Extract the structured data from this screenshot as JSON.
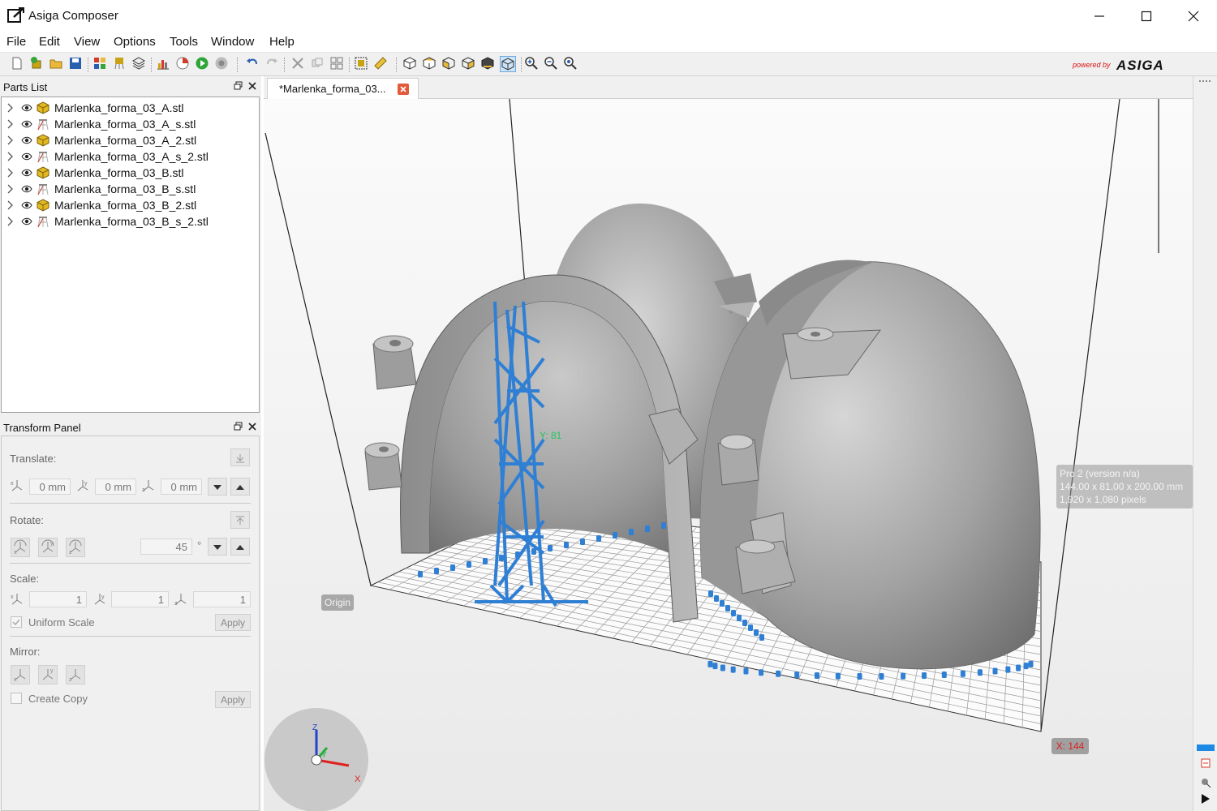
{
  "window": {
    "title": "Asiga Composer"
  },
  "menu": [
    "File",
    "Edit",
    "View",
    "Options",
    "Tools",
    "Window",
    "Help"
  ],
  "brand": {
    "powered": "powered by",
    "name": "ASIGA"
  },
  "parts_panel": {
    "title": "Parts List",
    "items": [
      {
        "label": "Marlenka_forma_03_A.stl",
        "kind": "part"
      },
      {
        "label": "Marlenka_forma_03_A_s.stl",
        "kind": "support"
      },
      {
        "label": "Marlenka_forma_03_A_2.stl",
        "kind": "part"
      },
      {
        "label": "Marlenka_forma_03_A_s_2.stl",
        "kind": "support"
      },
      {
        "label": "Marlenka_forma_03_B.stl",
        "kind": "part"
      },
      {
        "label": "Marlenka_forma_03_B_s.stl",
        "kind": "support"
      },
      {
        "label": "Marlenka_forma_03_B_2.stl",
        "kind": "part"
      },
      {
        "label": "Marlenka_forma_03_B_s_2.stl",
        "kind": "support"
      }
    ]
  },
  "transform_panel": {
    "title": "Transform Panel",
    "translate": {
      "label": "Translate:",
      "x": "0 mm",
      "y": "0 mm",
      "z": "0 mm"
    },
    "rotate": {
      "label": "Rotate:",
      "value": "45",
      "unit": "°"
    },
    "scale": {
      "label": "Scale:",
      "x": "1",
      "y": "1",
      "z": "1",
      "uniform_label": "Uniform Scale",
      "apply_label": "Apply"
    },
    "mirror": {
      "label": "Mirror:",
      "create_copy_label": "Create Copy",
      "apply_label": "Apply"
    }
  },
  "document": {
    "tab_label": "*Marlenka_forma_03..."
  },
  "viewport": {
    "printer_info": [
      "Pro 2 (version n/a)",
      "144.00 x 81.00 x 200.00 mm",
      "1,920 x 1,080 pixels"
    ],
    "origin_label": "Origin",
    "x_label": "X: 144",
    "y_label": "Y: 81",
    "axes": {
      "x": "X",
      "y": "Y",
      "z": "Z"
    }
  },
  "colors": {
    "support": "#2f7fd4",
    "part": "#9c9c9c",
    "background": "#f2f2f2",
    "accent": "#e02020"
  }
}
